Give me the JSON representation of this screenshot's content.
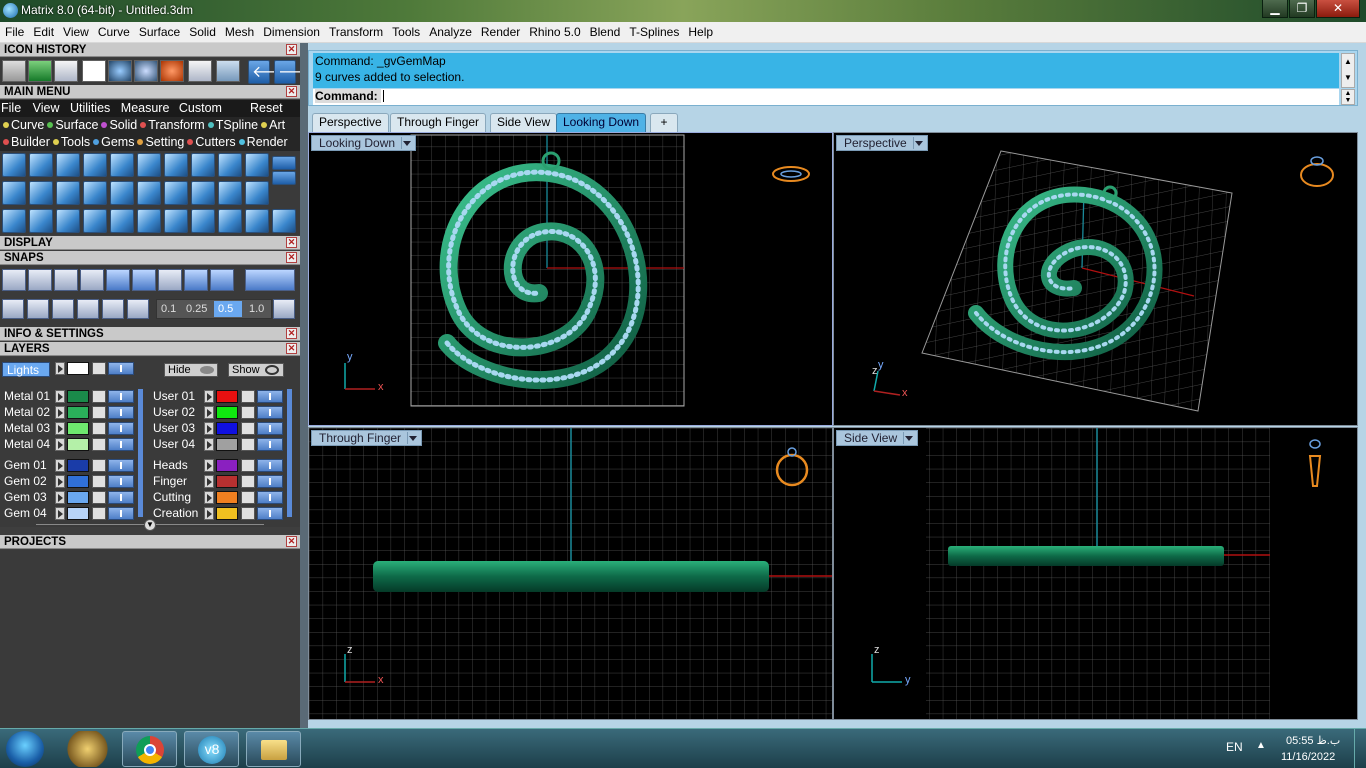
{
  "window": {
    "title": "Matrix 8.0 (64-bit) - Untitled.3dm",
    "min": "▁",
    "max": "❐",
    "close": "✕"
  },
  "menubar": [
    "File",
    "Edit",
    "View",
    "Curve",
    "Surface",
    "Solid",
    "Mesh",
    "Dimension",
    "Transform",
    "Tools",
    "Analyze",
    "Render",
    "Rhino 5.0",
    "Blend",
    "T-Splines",
    "Help"
  ],
  "left": {
    "icon_history": "ICON HISTORY",
    "main_menu": "MAIN MENU",
    "main_menu_items": [
      "File",
      "View",
      "Utilities",
      "Measure",
      "Custom"
    ],
    "reset": "Reset",
    "cat_row1": [
      {
        "label": "Curve",
        "color": "#e0d050"
      },
      {
        "label": "Surface",
        "color": "#58c050"
      },
      {
        "label": "Solid",
        "color": "#c050d0"
      },
      {
        "label": "Transform",
        "color": "#e05050"
      },
      {
        "label": "TSpline",
        "color": "#50c0c0"
      },
      {
        "label": "Art",
        "color": "#e0d050"
      }
    ],
    "cat_row2": [
      {
        "label": "Builder",
        "color": "#e05050"
      },
      {
        "label": "Tools",
        "color": "#e0d050"
      },
      {
        "label": "Gems",
        "color": "#50a0e0"
      },
      {
        "label": "Setting",
        "color": "#e0a040"
      },
      {
        "label": "Cutters",
        "color": "#e05050"
      },
      {
        "label": "Render",
        "color": "#50c0e0"
      }
    ],
    "display": "DISPLAY",
    "snaps": "SNAPS",
    "snap_values": [
      "0.1",
      "0.25",
      "0.5",
      "1.0"
    ],
    "info_settings": "INFO & SETTINGS",
    "layers": "LAYERS",
    "lights": "Lights",
    "hide": "Hide",
    "show": "Show",
    "layers_left": [
      {
        "name": "Metal 01",
        "color": "#1a8a4a"
      },
      {
        "name": "Metal 02",
        "color": "#2ab05a"
      },
      {
        "name": "Metal 03",
        "color": "#6ee86e"
      },
      {
        "name": "Metal 04",
        "color": "#b4f0a8"
      },
      {
        "name": "Gem 01",
        "color": "#1a3ca8"
      },
      {
        "name": "Gem 02",
        "color": "#3070d8"
      },
      {
        "name": "Gem 03",
        "color": "#6aa8f0"
      },
      {
        "name": "Gem 04",
        "color": "#b8d4f8"
      }
    ],
    "layers_right": [
      {
        "name": "User 01",
        "color": "#e81010"
      },
      {
        "name": "User 02",
        "color": "#10e810"
      },
      {
        "name": "User 03",
        "color": "#1010e0"
      },
      {
        "name": "User 04",
        "color": "#a0a0a0"
      },
      {
        "name": "Heads",
        "color": "#8a20c0"
      },
      {
        "name": "Finger",
        "color": "#b83030"
      },
      {
        "name": "Cutting",
        "color": "#f08020"
      },
      {
        "name": "Creation",
        "color": "#f0c020"
      }
    ],
    "projects": "PROJECTS"
  },
  "command": {
    "line1": "Command: _gvGemMap",
    "line2": "9 curves added to selection.",
    "prompt": "Command:"
  },
  "tabs": [
    "Perspective",
    "Through Finger",
    "Side View",
    "Looking Down",
    "+"
  ],
  "active_tab": "Looking Down",
  "viewports": {
    "tl": "Looking Down",
    "tr": "Perspective",
    "bl": "Through Finger",
    "br": "Side View"
  },
  "axes": {
    "x": "x",
    "y": "y",
    "z": "z"
  },
  "taskbar": {
    "lang": "EN",
    "time": "05:55 ب.ظ",
    "date": "11/16/2022"
  },
  "colors": {
    "accent": "#38b4e6",
    "model": "#1d8a62",
    "gem": "#a8d8f0"
  }
}
